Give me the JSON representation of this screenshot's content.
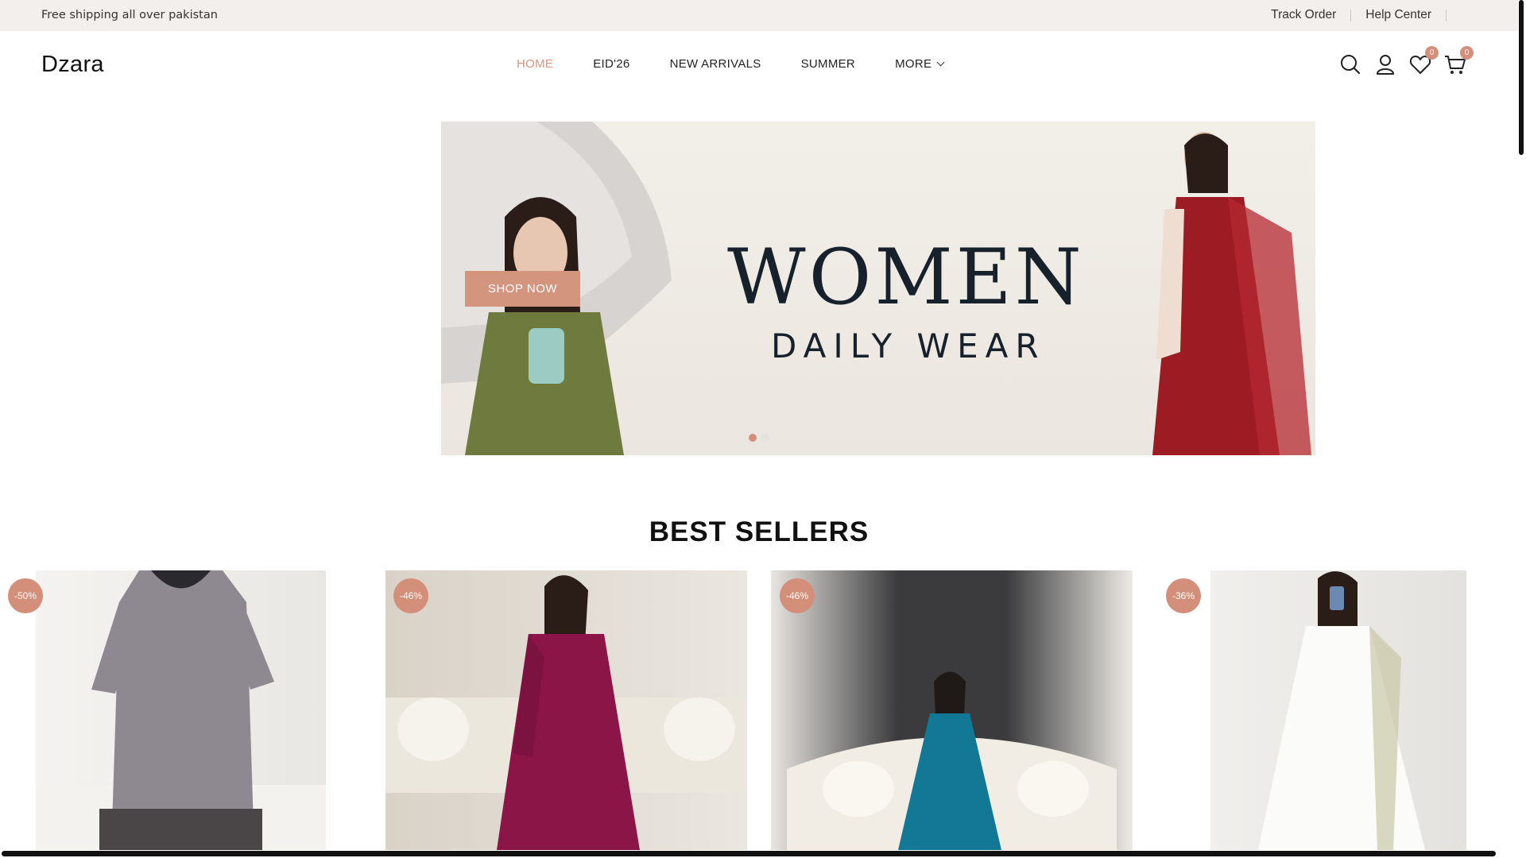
{
  "topbar": {
    "shipping_text": "Free shipping all over pakistan",
    "track_order": "Track Order",
    "help_center": "Help Center"
  },
  "header": {
    "logo": "Dzara",
    "nav": [
      "HOME",
      "EID'26",
      "NEW ARRIVALS",
      "SUMMER",
      "MORE"
    ],
    "active_nav": "HOME",
    "wishlist_count": "0",
    "cart_count": "0"
  },
  "hero": {
    "button": "SHOP NOW",
    "title": "WOMEN",
    "subtitle": "DAILY WEAR",
    "slides": 2,
    "active_slide": 1
  },
  "best_sellers": {
    "title": "BEST SELLERS",
    "products": [
      {
        "discount": "-50%",
        "color": "grey"
      },
      {
        "discount": "-46%",
        "color": "magenta"
      },
      {
        "discount": "-46%",
        "color": "teal"
      },
      {
        "discount": "-36%",
        "color": "white"
      }
    ]
  },
  "colors": {
    "accent": "#d48f7a",
    "topbar_bg": "#f3efec",
    "text_dark": "#17212b"
  }
}
